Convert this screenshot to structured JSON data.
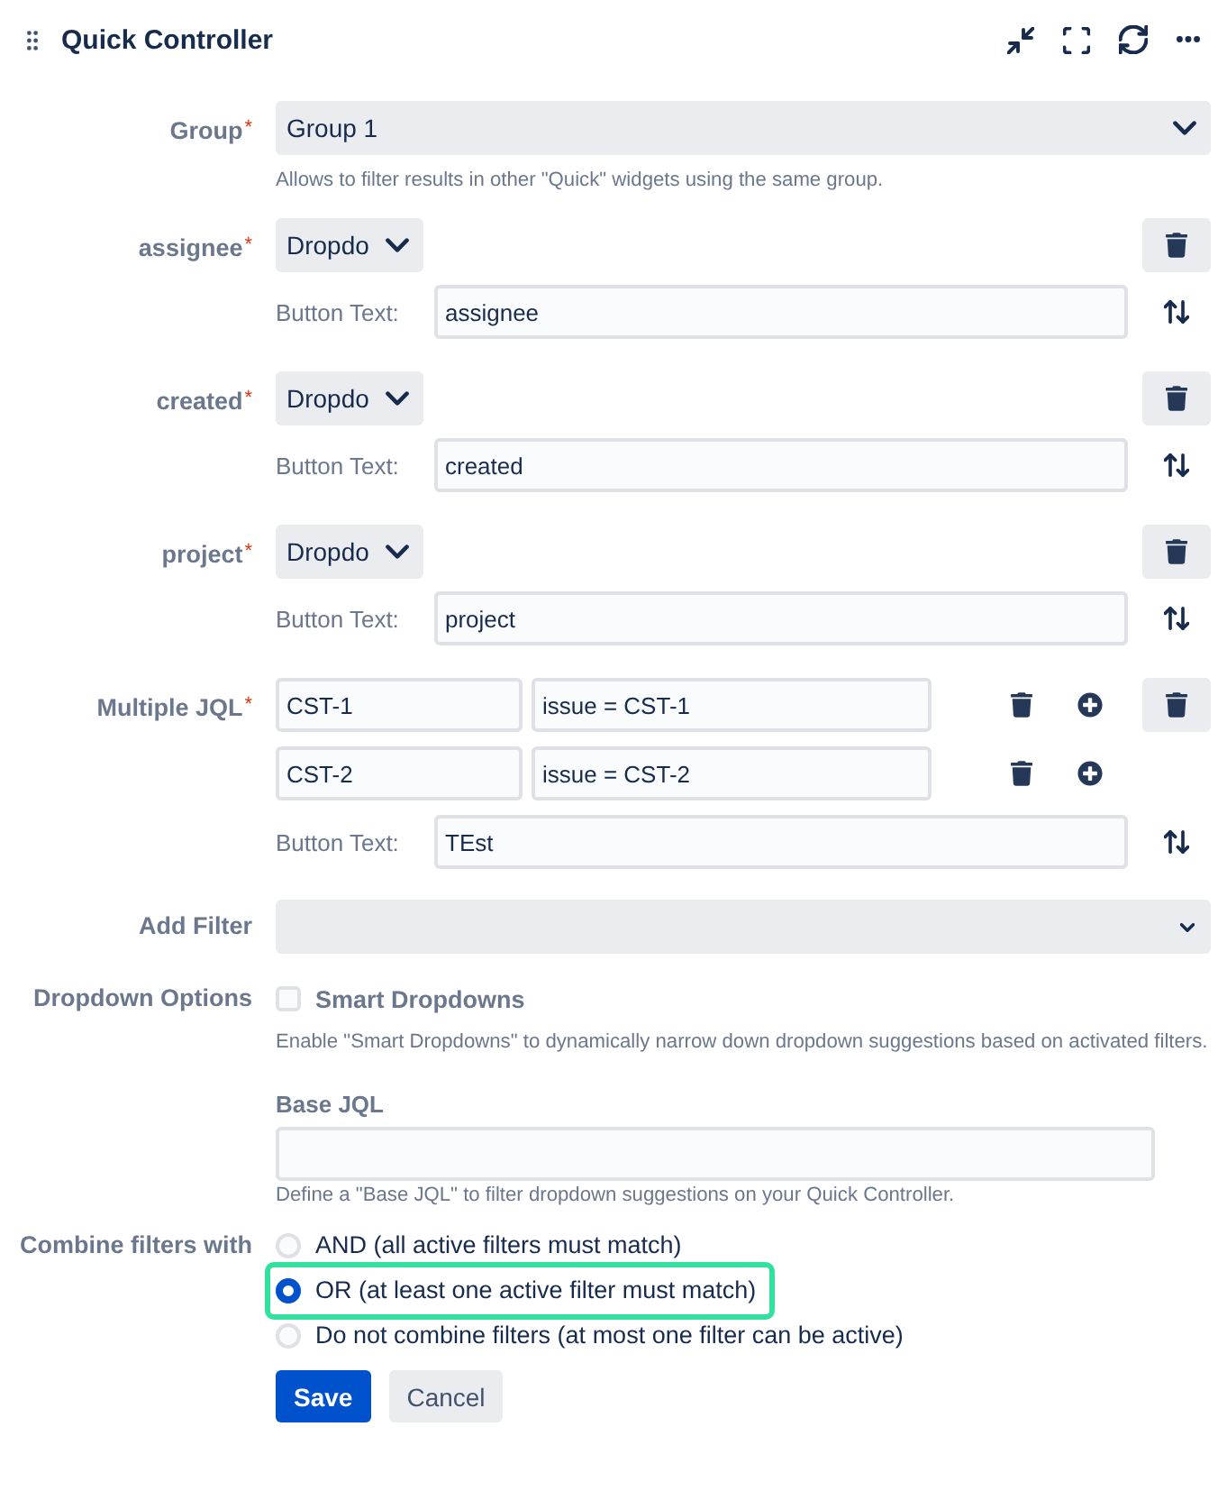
{
  "header": {
    "title": "Quick Controller"
  },
  "group": {
    "label": "Group",
    "required_mark": "*",
    "value": "Group 1",
    "help": "Allows to filter results in other \"Quick\" widgets using the same group."
  },
  "filters": [
    {
      "kind": "dropdown",
      "label": "assignee",
      "required_mark": "*",
      "type": "Dropdo",
      "button_text_label": "Button Text:",
      "button_text": "assignee"
    },
    {
      "kind": "dropdown",
      "label": "created",
      "required_mark": "*",
      "type": "Dropdo",
      "button_text_label": "Button Text:",
      "button_text": "created"
    },
    {
      "kind": "dropdown",
      "label": "project",
      "required_mark": "*",
      "type": "Dropdo",
      "button_text_label": "Button Text:",
      "button_text": "project"
    },
    {
      "kind": "multiple_jql",
      "label": "Multiple JQL",
      "required_mark": "*",
      "queries": [
        {
          "name": "CST-1",
          "jql": "issue = CST-1"
        },
        {
          "name": "CST-2",
          "jql": "issue = CST-2"
        }
      ],
      "button_text_label": "Button Text:",
      "button_text": "TEst"
    }
  ],
  "add_filter": {
    "label": "Add Filter"
  },
  "dropdown_options": {
    "label": "Dropdown Options",
    "option": {
      "label": "Smart Dropdowns",
      "checked": false
    },
    "help": "Enable \"Smart Dropdowns\" to dynamically narrow down dropdown suggestions based on activated filters."
  },
  "base_jql": {
    "label": "Base JQL",
    "help": "Define a \"Base JQL\" to filter dropdown suggestions on your Quick Controller."
  },
  "combine": {
    "label": "Combine filters with",
    "options": [
      {
        "label": "AND (all active filters must match)",
        "selected": false,
        "highlighted": false
      },
      {
        "label": "OR (at least one active filter must match)",
        "selected": true,
        "highlighted": true
      },
      {
        "label": "Do not combine filters (at most one filter can be active)",
        "selected": false,
        "highlighted": false
      }
    ]
  },
  "buttons": [
    {
      "kind": "primary",
      "label": "Save"
    },
    {
      "kind": "secondary",
      "label": "Cancel"
    }
  ]
}
